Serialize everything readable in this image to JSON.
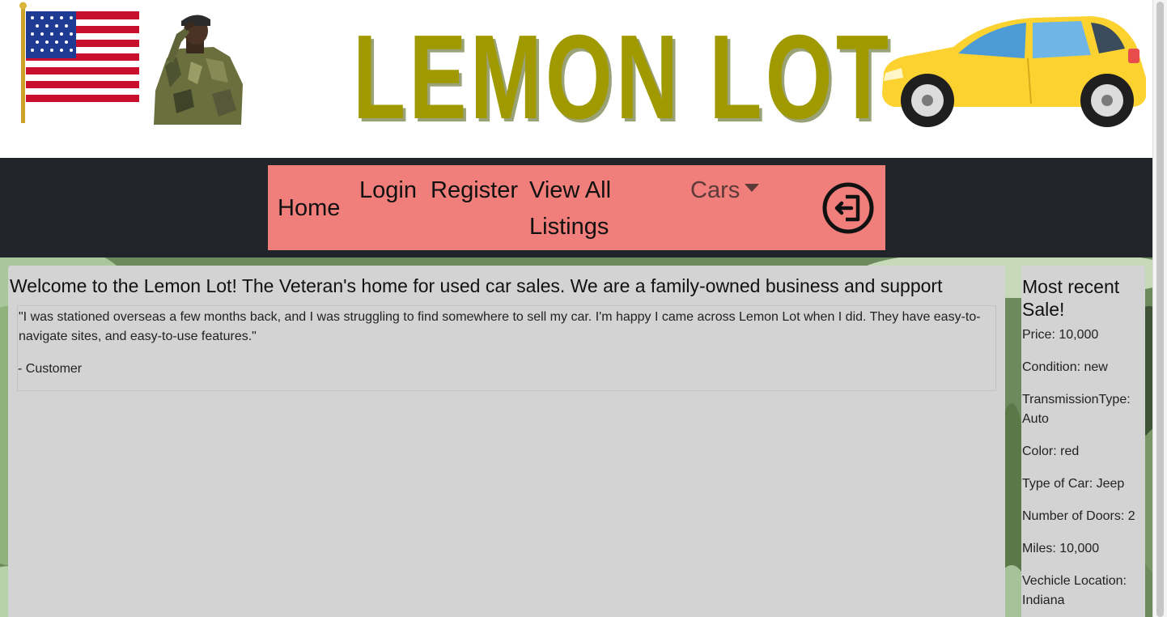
{
  "header": {
    "logo_text": "LEMON LOT",
    "flag_icon": "american-flag",
    "soldier_icon": "saluting-soldier",
    "car_icon": "yellow-hatchback-car"
  },
  "nav": {
    "home": "Home",
    "login": "Login",
    "register": "Register",
    "view_all": "View All Listings",
    "cars": "Cars",
    "logout_icon": "logout-icon",
    "background": "#f07f7c",
    "bar_color": "#212529"
  },
  "main": {
    "welcome": "Welcome to the Lemon Lot! The Veteran's home for used car sales. We are a family-owned business and support",
    "testimonial": {
      "quote": "\"I was stationed overseas a few months back, and I was struggling to find somewhere to sell my car. I'm happy I came across Lemon Lot when I did. They have easy-to-navigate sites, and easy-to-use features.\"",
      "attribution": "- Customer"
    }
  },
  "recent_sale": {
    "title": "Most recent Sale!",
    "items": [
      "Price: 10,000",
      "Condition: new",
      "TransmissionType: Auto",
      "Color: red",
      "Type of Car: Jeep",
      "Number of Doors: 2",
      "Miles: 10,000",
      "Vechicle Location: Indiana"
    ]
  }
}
